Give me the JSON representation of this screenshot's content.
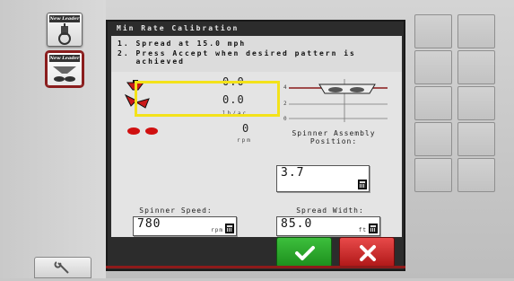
{
  "dialog": {
    "title": "Min Rate Calibration"
  },
  "instructions": [
    "1. Spread at 15.0 mph",
    "2. Press Accept when desired pattern is",
    "   achieved"
  ],
  "readouts": {
    "row1_value": "0.0",
    "row2_value": "0.0",
    "row2_unit": "lb/ac",
    "row3_value": "0",
    "row3_unit": "rpm"
  },
  "scale": {
    "labels": [
      "4",
      "2",
      "0"
    ]
  },
  "spinner_position": {
    "label": "Spinner Assembly Position:",
    "value": "3.7"
  },
  "spinner_speed": {
    "label": "Spinner Speed:",
    "value": "780",
    "unit": "rpm"
  },
  "spread_width": {
    "label": "Spread Width:",
    "value": "85.0",
    "unit": "ft"
  },
  "softkeys": {
    "brand1": "New Leader",
    "brand2": "New Leader"
  },
  "colors": {
    "accept": "#2aa52a",
    "cancel": "#d02a2a",
    "highlight": "#f3e21a",
    "spinner": "#d01010"
  }
}
